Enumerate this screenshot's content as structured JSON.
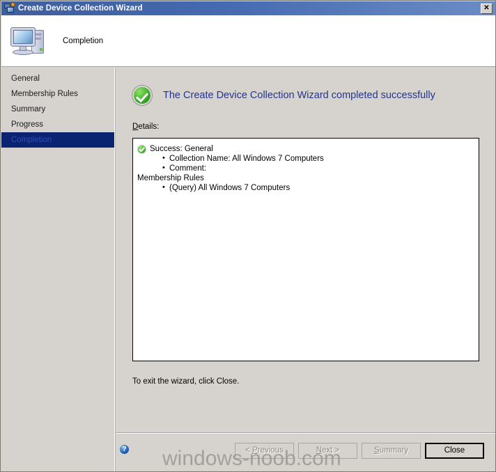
{
  "window": {
    "title": "Create Device Collection Wizard",
    "title_icon": "computer-network-icon",
    "close_label": "✕"
  },
  "header": {
    "page_title": "Completion",
    "icon": "computer-icon"
  },
  "sidebar": {
    "items": [
      {
        "label": "General",
        "selected": false
      },
      {
        "label": "Membership Rules",
        "selected": false
      },
      {
        "label": "Summary",
        "selected": false
      },
      {
        "label": "Progress",
        "selected": false
      },
      {
        "label": "Completion",
        "selected": true
      }
    ]
  },
  "main": {
    "status_icon": "green-check-circle-icon",
    "success_heading": "The Create Device Collection Wizard completed successfully",
    "details_label_accel": "D",
    "details_label_rest": "etails:",
    "details": {
      "success_icon": "green-check-small-icon",
      "success_line": "Success: General",
      "success_bullets": [
        "Collection Name: All Windows 7 Computers",
        "Comment:"
      ],
      "section_line": "Membership Rules",
      "section_bullets": [
        "(Query) All Windows 7 Computers"
      ]
    },
    "exit_note": "To exit the wizard, click Close."
  },
  "footer": {
    "help_icon": "help-question-icon",
    "help_glyph": "?",
    "buttons": [
      {
        "name": "previous",
        "prefix": "< ",
        "accel": "P",
        "suffix": "revious",
        "disabled": true,
        "default": false
      },
      {
        "name": "next",
        "prefix": "",
        "accel": "N",
        "suffix": "ext >",
        "disabled": true,
        "default": false
      },
      {
        "name": "summary",
        "prefix": "",
        "accel": "S",
        "suffix": "ummary",
        "disabled": true,
        "default": false
      },
      {
        "name": "close",
        "prefix": "",
        "accel": "",
        "suffix": "Close",
        "disabled": false,
        "default": true
      }
    ]
  },
  "watermark": {
    "text": "windows-noob.com"
  },
  "colors": {
    "window_bg": "#d6d3ce",
    "titlebar_start": "#3f5e9e",
    "titlebar_end": "#6b8cc6",
    "heading_blue": "#24348c",
    "selection_navy": "#0b2472",
    "success_green": "#3fae2a"
  }
}
